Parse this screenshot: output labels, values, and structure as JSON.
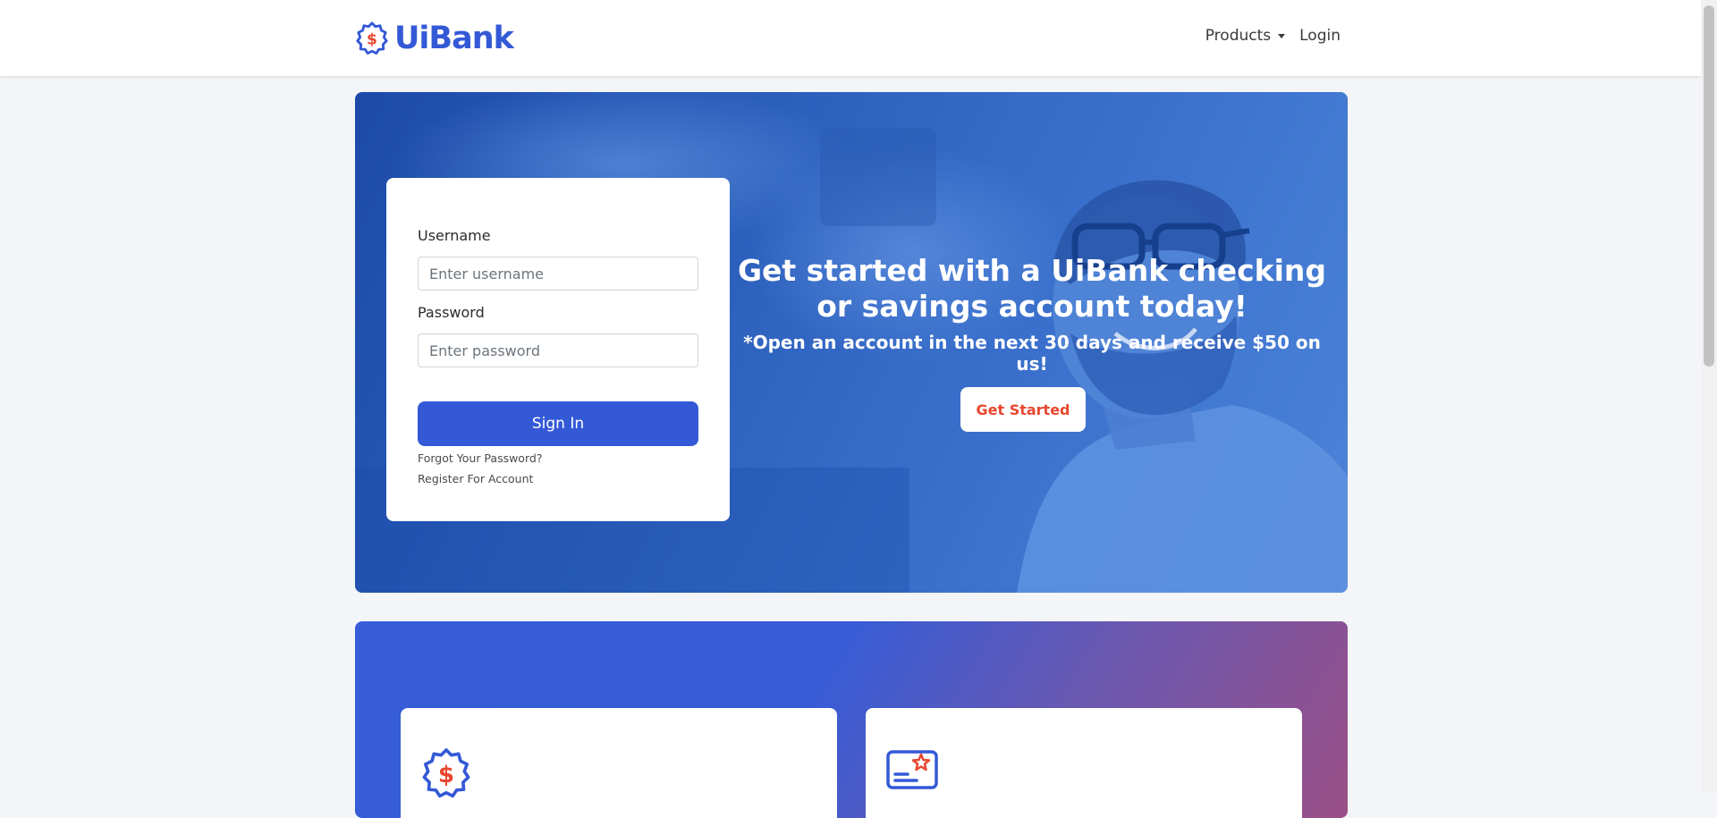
{
  "brand": {
    "name": "UiBank",
    "logo_icon": "dollar-badge-icon"
  },
  "nav": {
    "products": "Products",
    "login": "Login"
  },
  "login_form": {
    "username_label": "Username",
    "username_placeholder": "Enter username",
    "password_label": "Password",
    "password_placeholder": "Enter password",
    "signin_label": "Sign In",
    "forgot_password": "Forgot Your Password?",
    "register": "Register For Account"
  },
  "hero": {
    "title": "Get started with a UiBank checking or savings account today!",
    "subtitle": "*Open an account in the next 30 days and receive $50 on us!",
    "cta_label": "Get Started"
  },
  "features": {
    "icons": [
      "dollar-badge-icon",
      "id-card-star-icon"
    ]
  },
  "colors": {
    "brand_blue": "#3459d6",
    "accent_red": "#e8462f"
  }
}
